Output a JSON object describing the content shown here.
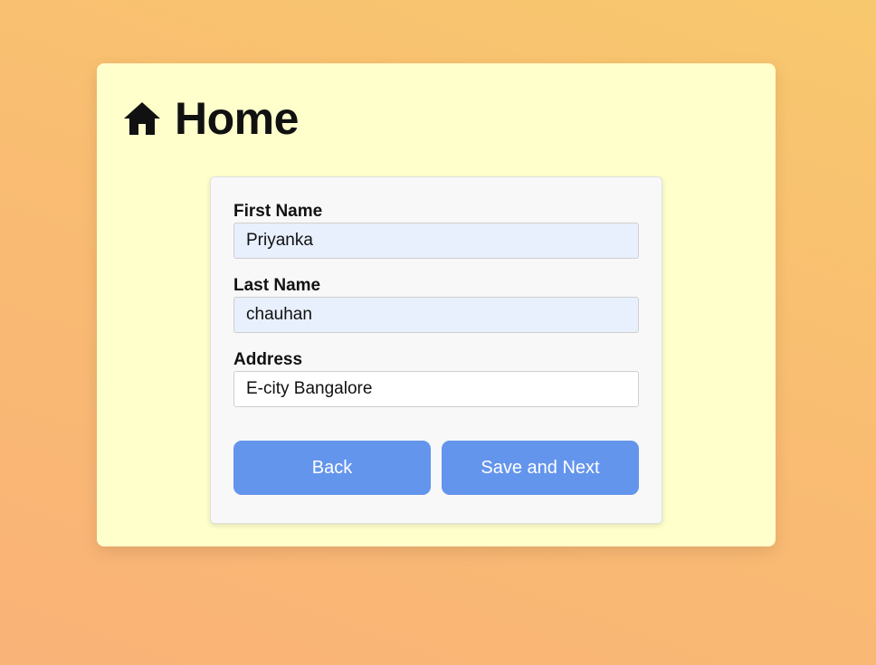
{
  "header": {
    "title": "Home",
    "icon": "home-icon"
  },
  "form": {
    "fields": [
      {
        "label": "First Name",
        "value": "Priyanka",
        "autofilled": true
      },
      {
        "label": "Last Name",
        "value": "chauhan",
        "autofilled": true
      },
      {
        "label": "Address",
        "value": "E-city Bangalore",
        "autofilled": false
      }
    ],
    "buttons": {
      "back_label": "Back",
      "save_next_label": "Save and Next"
    }
  },
  "colors": {
    "card_background": "#ffffcc",
    "button_accent": "#6495ed",
    "autofill_background": "#e8f0fe"
  }
}
